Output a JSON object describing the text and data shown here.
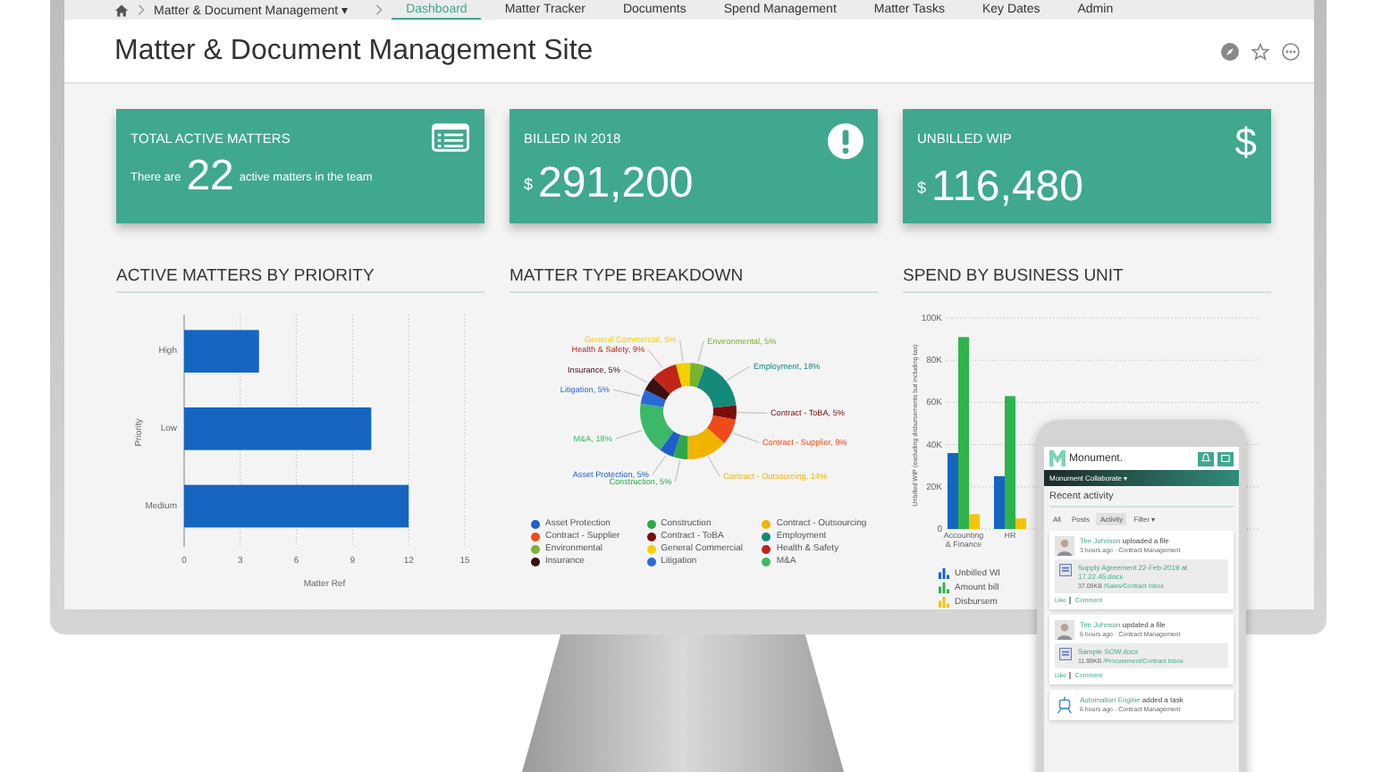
{
  "nav": {
    "breadcrumb": "Matter & Document Management ▾",
    "tabs": [
      {
        "label": "Dashboard",
        "selected": true
      },
      {
        "label": "Matter Tracker",
        "selected": false
      },
      {
        "label": "Documents",
        "selected": false
      },
      {
        "label": "Spend Management",
        "selected": false
      },
      {
        "label": "Matter Tasks",
        "selected": false
      },
      {
        "label": "Key Dates",
        "selected": false
      },
      {
        "label": "Admin",
        "selected": false
      }
    ]
  },
  "site_title": "Matter & Document Management Site",
  "cards": [
    {
      "kind": "count",
      "title": "TOTAL ACTIVE MATTERS",
      "before": "There are",
      "value": "22",
      "after": "active matters in the team"
    },
    {
      "kind": "money",
      "title": "BILLED IN 2018",
      "prefix": "$",
      "value": "291,200"
    },
    {
      "kind": "money",
      "icon_text": "$",
      "title": "UNBILLED WIP",
      "prefix": "$",
      "value": "116,480"
    }
  ],
  "charts": [
    {
      "title": "ACTIVE MATTERS BY PRIORITY",
      "chart_data": {
        "type": "bar",
        "orientation": "horizontal",
        "grid": true,
        "xlabel": "Matter Ref",
        "ylabel": "Priority",
        "categories": [
          "High",
          "Low",
          "Medium"
        ],
        "series": [
          {
            "color": "#1565c0",
            "values": [
              4,
              10,
              12
            ]
          }
        ],
        "xlim": [
          0,
          15
        ],
        "xticks": [
          0,
          3,
          6,
          9,
          12,
          15
        ]
      }
    },
    {
      "title": "MATTER TYPE BREAKDOWN",
      "chart_data": {
        "type": "donut",
        "categories": [
          "Employment, 18%",
          "Contract - ToBA, 5%",
          "Contract - Supplier, 9%",
          "Contract - Outsourcing, 14%",
          "Construction, 5%",
          "Asset Protection, 5%",
          "M&A, 18%",
          "Litigation, 5%",
          "Insurance, 5%",
          "Health & Safety, 9%",
          "General Commercial, 5%",
          "Environmental, 5%"
        ],
        "series": [
          {
            "values": [
              18,
              5,
              9,
              14,
              5,
              5,
              18,
              5,
              5,
              9,
              5,
              5
            ],
            "colors": [
              "#138a7a",
              "#7a0e0e",
              "#f04a1a",
              "#f0b400",
              "#2ea84a",
              "#1e5fc8",
              "#3cb868",
              "#2a6ad8",
              "#3a1010",
              "#c0241a",
              "#f5d000",
              "#7ab32e"
            ]
          }
        ]
      },
      "legend": [
        {
          "label": "Asset Protection",
          "color": "#1e5fc8"
        },
        {
          "label": "Construction",
          "color": "#2ea84a"
        },
        {
          "label": "Contract - Outsourcing",
          "color": "#f0b400"
        },
        {
          "label": "Contract - Supplier",
          "color": "#f04a1a"
        },
        {
          "label": "Contract - ToBA",
          "color": "#7a0e0e"
        },
        {
          "label": "Employment",
          "color": "#138a7a"
        },
        {
          "label": "Environmental",
          "color": "#7ab32e"
        },
        {
          "label": "General Commercial",
          "color": "#f5d000"
        },
        {
          "label": "Health & Safety",
          "color": "#c0241a"
        },
        {
          "label": "Insurance",
          "color": "#3a1010"
        },
        {
          "label": "Litigation",
          "color": "#2a6ad8"
        },
        {
          "label": "M&A",
          "color": "#3cb868"
        }
      ]
    },
    {
      "title": "SPEND BY BUSINESS UNIT",
      "chart_data": {
        "type": "bar",
        "stacked": false,
        "grid": true,
        "ylabel": "Unbilled WIP (excluding disbursements but including tax)",
        "categories": [
          "Accounting & Finance",
          "HR"
        ],
        "series": [
          {
            "name": "Unbilled WI",
            "color": "#1565c0",
            "values": [
              36000,
              25000
            ]
          },
          {
            "name": "Amount bill",
            "color": "#2eb34a",
            "values": [
              91000,
              63000
            ]
          },
          {
            "name": "Disbursem",
            "color": "#f5c400",
            "values": [
              7000,
              5000
            ]
          }
        ],
        "ylim": [
          0,
          100000
        ],
        "yticks": [
          {
            "value": 0,
            "label": "0"
          },
          {
            "value": 20000,
            "label": "20K"
          },
          {
            "value": 40000,
            "label": "40K"
          },
          {
            "value": 60000,
            "label": "60K"
          },
          {
            "value": 80000,
            "label": "80K"
          },
          {
            "value": 100000,
            "label": "100K"
          }
        ]
      }
    }
  ],
  "phone": {
    "logo": "Monument.",
    "bar": "Monument Collaborate ▾",
    "heading": "Recent activity",
    "tabs": [
      {
        "label": "All",
        "selected": false
      },
      {
        "label": "Posts",
        "selected": false
      },
      {
        "label": "Activity",
        "selected": true
      },
      {
        "label": "Filter ▾",
        "selected": false
      }
    ],
    "items": [
      {
        "kind": "file",
        "actor": "Tim Johnson",
        "action": "uploaded a file",
        "meta": "3 hours ago · Contract Management",
        "file": "Supply Agreement 22-Feb-2019 at 17.22.45.docx",
        "size": "37.09KB",
        "path": "/Sales/Contract Inbox",
        "like": "Like",
        "comment": "Comment"
      },
      {
        "kind": "file",
        "actor": "Tim Johnson",
        "action": "updated a file",
        "meta": "6 hours ago · Contract Management",
        "file": "Sample SOW.docx",
        "size": "11.99KB",
        "path": "/Procurement/Contract Inbox",
        "like": "Like",
        "comment": "Comment"
      },
      {
        "kind": "task",
        "actor": "Automation Engine",
        "action": "added a task",
        "meta": "6 hours ago · Contract Management"
      }
    ]
  }
}
